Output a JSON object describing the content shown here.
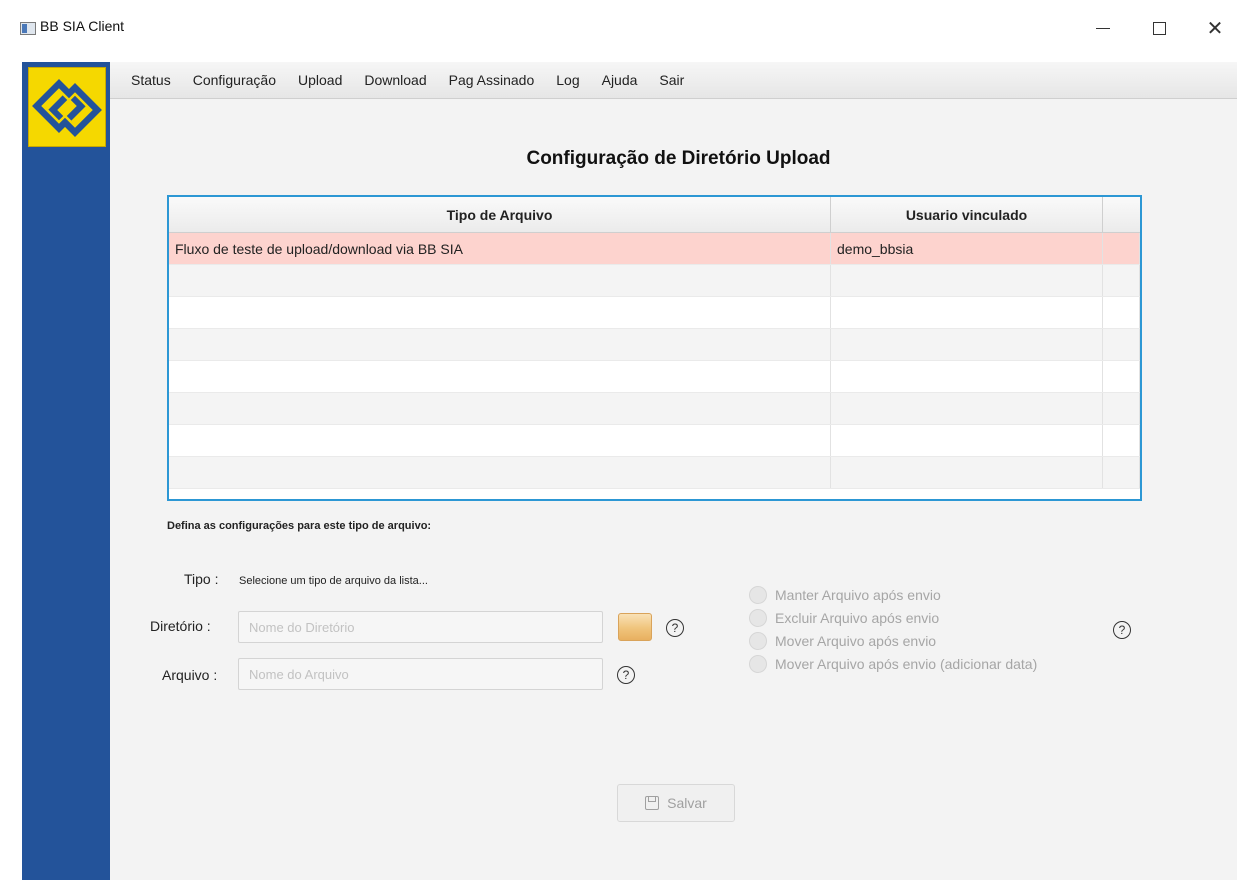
{
  "window": {
    "title": "BB SIA Client",
    "controls": {
      "minimize": "minimize-icon",
      "maximize": "maximize-icon",
      "close": "✕"
    }
  },
  "brand": {
    "logo": "banco-do-brasil-logo",
    "accent": "#23539a",
    "logo_color": "#f5d800"
  },
  "menu": [
    "Status",
    "Configuração",
    "Upload",
    "Download",
    "Pag Assinado",
    "Log",
    "Ajuda",
    "Sair"
  ],
  "page": {
    "title": "Configuração de Diretório Upload"
  },
  "table": {
    "headers": [
      "Tipo de Arquivo",
      "Usuario vinculado",
      ""
    ],
    "rows": [
      [
        "Fluxo de teste de upload/download via BB SIA",
        "demo_bbsia",
        ""
      ]
    ],
    "selected_row": 0,
    "selected_color": "#fdd3ce",
    "border_color": "#2c97d4"
  },
  "form": {
    "section_label": "Defina as configurações para este tipo de arquivo:",
    "tipo_label": "Tipo :",
    "tipo_value": "Selecione um tipo de arquivo da lista...",
    "diretorio_label": "Diretório :",
    "diretorio_placeholder": "Nome do Diretório",
    "diretorio_value": "",
    "arquivo_label": "Arquivo :",
    "arquivo_placeholder": "Nome do Arquivo",
    "arquivo_value": "",
    "help_glyph": "?",
    "options": [
      "Manter Arquivo após envio",
      "Excluir Arquivo após envio",
      "Mover Arquivo após envio",
      "Mover Arquivo após envio (adicionar data)"
    ],
    "save_label": "Salvar"
  }
}
